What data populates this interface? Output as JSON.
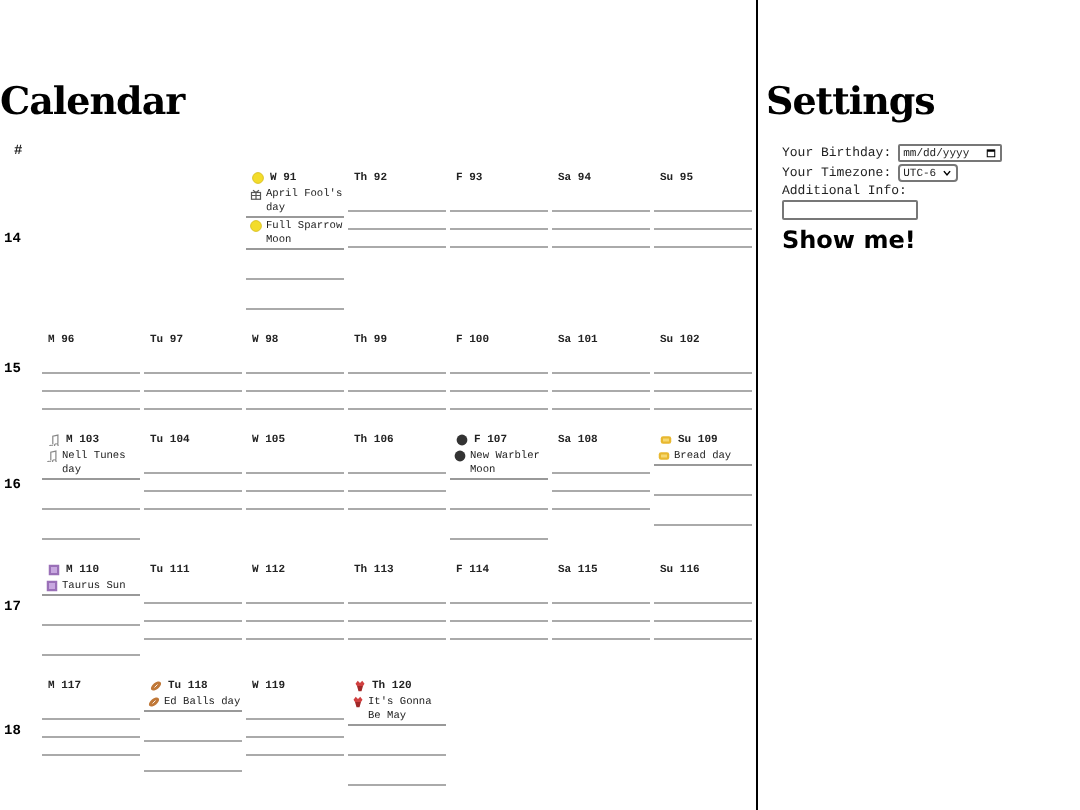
{
  "calendar": {
    "title": "Calendar",
    "week_header": "#",
    "weeks": [
      {
        "label": "14",
        "days": [
          {
            "kind": "empty"
          },
          {
            "kind": "empty"
          },
          {
            "kind": "fullmoon",
            "label": "W 91",
            "events": [
              {
                "kind": "gift",
                "text": "April Fool's day"
              },
              {
                "kind": "fullmoon",
                "text": "Full Sparrow Moon"
              }
            ]
          },
          {
            "kind": "day",
            "label": "Th 92"
          },
          {
            "kind": "day",
            "label": "F 93"
          },
          {
            "kind": "day",
            "label": "Sa 94"
          },
          {
            "kind": "day",
            "label": "Su 95"
          }
        ]
      },
      {
        "label": "15",
        "days": [
          {
            "kind": "day",
            "label": "M 96"
          },
          {
            "kind": "day",
            "label": "Tu 97"
          },
          {
            "kind": "day",
            "label": "W 98"
          },
          {
            "kind": "day",
            "label": "Th 99"
          },
          {
            "kind": "day",
            "label": "F 100"
          },
          {
            "kind": "day",
            "label": "Sa 101"
          },
          {
            "kind": "day",
            "label": "Su 102"
          }
        ]
      },
      {
        "label": "16",
        "days": [
          {
            "kind": "music",
            "label": "M 103",
            "events": [
              {
                "kind": "music",
                "text": "Nell Tunes day"
              }
            ]
          },
          {
            "kind": "day",
            "label": "Tu 104"
          },
          {
            "kind": "day",
            "label": "W 105"
          },
          {
            "kind": "day",
            "label": "Th 106"
          },
          {
            "kind": "newmoon",
            "label": "F 107",
            "events": [
              {
                "kind": "newmoon",
                "text": "New Warbler Moon"
              }
            ]
          },
          {
            "kind": "day",
            "label": "Sa 108"
          },
          {
            "kind": "bread",
            "label": "Su 109",
            "events": [
              {
                "kind": "bread",
                "text": "Bread day"
              }
            ]
          }
        ]
      },
      {
        "label": "17",
        "days": [
          {
            "kind": "zodiac",
            "label": "M 110",
            "events": [
              {
                "kind": "zodiac",
                "text": "Taurus Sun"
              }
            ]
          },
          {
            "kind": "day",
            "label": "Tu 111"
          },
          {
            "kind": "day",
            "label": "W 112"
          },
          {
            "kind": "day",
            "label": "Th 113"
          },
          {
            "kind": "day",
            "label": "F 114"
          },
          {
            "kind": "day",
            "label": "Sa 115"
          },
          {
            "kind": "day",
            "label": "Su 116"
          }
        ]
      },
      {
        "label": "18",
        "days": [
          {
            "kind": "day",
            "label": "M 117"
          },
          {
            "kind": "football",
            "label": "Tu 118",
            "events": [
              {
                "kind": "football",
                "text": "Ed Balls day"
              }
            ]
          },
          {
            "kind": "day",
            "label": "W 119"
          },
          {
            "kind": "flower",
            "label": "Th 120",
            "events": [
              {
                "kind": "flower",
                "text": "It's Gonna Be May"
              }
            ]
          },
          {
            "kind": "empty"
          },
          {
            "kind": "empty"
          },
          {
            "kind": "empty"
          }
        ]
      }
    ]
  },
  "settings": {
    "title": "Settings",
    "fields": [
      {
        "kind": "date",
        "label": "Your Birthday:",
        "placeholder": "mm/dd/yyyy"
      },
      {
        "kind": "select",
        "label": "Your Timezone:",
        "value": "UTC-6"
      },
      {
        "kind": "text",
        "label": "Additional Info:"
      }
    ],
    "button": "Show me!"
  }
}
